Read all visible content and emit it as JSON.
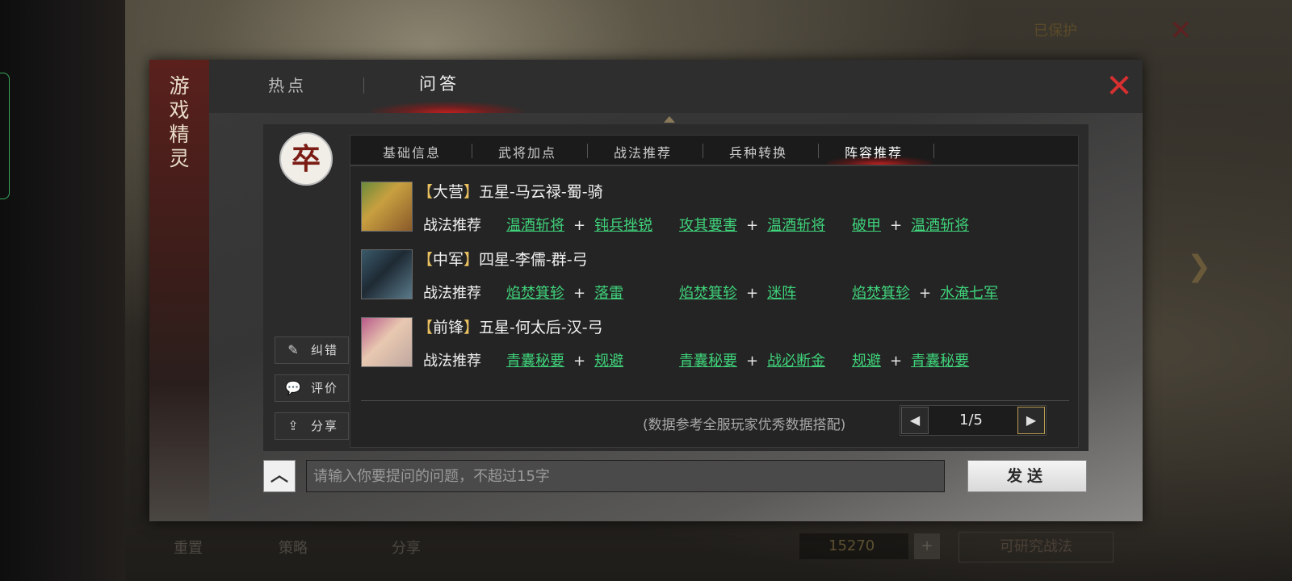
{
  "background": {
    "nav_items": [
      "",
      "",
      "",
      ""
    ],
    "protect_label": "已保护",
    "bottom_items": [
      "重置",
      "策略",
      "分享"
    ],
    "coins": "15270",
    "plus": "+",
    "learn_button": "可研究战法"
  },
  "modal": {
    "side_title": [
      "游",
      "戏",
      "精",
      "灵"
    ],
    "tabs": [
      {
        "label": "热点",
        "active": false
      },
      {
        "label": "问答",
        "active": true
      }
    ],
    "close_icon": "close-icon",
    "avatar_char": "卒",
    "side_buttons": [
      {
        "label": "纠错",
        "icon": "edit-icon"
      },
      {
        "label": "评价",
        "icon": "comment-icon"
      },
      {
        "label": "分享",
        "icon": "share-icon"
      }
    ],
    "subtabs": [
      {
        "label": "基础信息",
        "active": false
      },
      {
        "label": "武将加点",
        "active": false
      },
      {
        "label": "战法推荐",
        "active": false
      },
      {
        "label": "兵种转换",
        "active": false
      },
      {
        "label": "阵容推荐",
        "active": true
      }
    ],
    "heroes": [
      {
        "position": "大营",
        "name": "五星-马云禄-蜀-骑",
        "rec_label": "战法推荐",
        "combos": [
          [
            "温酒斩将",
            "钝兵挫锐"
          ],
          [
            "攻其要害",
            "温酒斩将"
          ],
          [
            "破甲",
            "温酒斩将"
          ]
        ]
      },
      {
        "position": "中军",
        "name": "四星-李儒-群-弓",
        "rec_label": "战法推荐",
        "combos": [
          [
            "焰焚箕轸",
            "落雷"
          ],
          [
            "焰焚箕轸",
            "迷阵"
          ],
          [
            "焰焚箕轸",
            "水淹七军"
          ]
        ]
      },
      {
        "position": "前锋",
        "name": "五星-何太后-汉-弓",
        "rec_label": "战法推荐",
        "combos": [
          [
            "青囊秘要",
            "规避"
          ],
          [
            "青囊秘要",
            "战必断金"
          ],
          [
            "规避",
            "青囊秘要"
          ]
        ]
      }
    ],
    "plus_sign": "+",
    "footnote": "(数据参考全服玩家优秀数据搭配)",
    "pager": {
      "current": "1",
      "total": "5",
      "text": "1/5"
    },
    "input": {
      "placeholder": "请输入你要提问的问题，不超过15字",
      "value": ""
    },
    "send_label": "发送"
  }
}
